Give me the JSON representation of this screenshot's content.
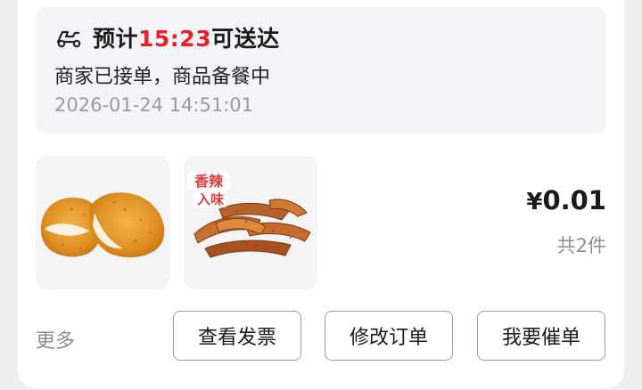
{
  "delivery": {
    "eta_prefix": "预计",
    "eta_time": "15:23",
    "eta_suffix": "可送达",
    "status": "商家已接单，商品备餐中",
    "timestamp": "2026-01-24 14:51:01",
    "icon": "scooter-icon"
  },
  "items": [
    {
      "image": "fried-chicken-cutlet"
    },
    {
      "image": "spicy-potato-wedges",
      "badge": [
        "香辣",
        "入味"
      ]
    }
  ],
  "summary": {
    "currency": "¥",
    "amount": "0.01",
    "count": "共2件"
  },
  "actions": {
    "more": "更多",
    "invoice": "查看发票",
    "modify": "修改订单",
    "urge": "我要催单"
  },
  "colors": {
    "accent_red": "#e8202a",
    "page_bg": "#eeeef0",
    "status_bg": "#f3f4f8"
  }
}
